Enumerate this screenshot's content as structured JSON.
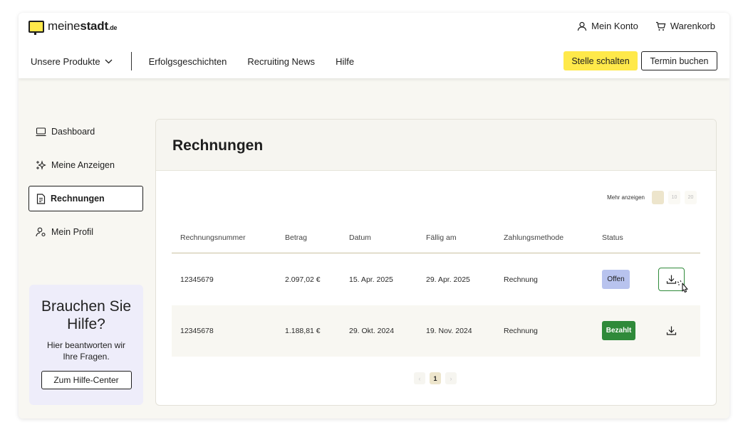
{
  "header": {
    "logo": {
      "pre": "meine",
      "bold": "stadt",
      "suffix": ".de"
    },
    "account_label": "Mein Konto",
    "cart_label": "Warenkorb",
    "products_label": "Unsere Produkte",
    "nav": [
      "Erfolgsgeschichten",
      "Recruiting News",
      "Hilfe"
    ],
    "cta_primary": "Stelle schalten",
    "cta_secondary": "Termin buchen"
  },
  "sidebar": {
    "items": [
      {
        "label": "Dashboard",
        "icon": "laptop-icon"
      },
      {
        "label": "Meine Anzeigen",
        "icon": "sparkle-icon"
      },
      {
        "label": "Rechnungen",
        "icon": "document-icon",
        "active": true
      },
      {
        "label": "Mein Profil",
        "icon": "user-settings-icon"
      }
    ],
    "help": {
      "title": "Brauchen Sie Hilfe?",
      "text": "Hier beantworten wir Ihre Fragen.",
      "button": "Zum Hilfe-Center"
    }
  },
  "main": {
    "title": "Rechnungen",
    "more_label": "Mehr anzeigen",
    "page_size_options": [
      "5",
      "10",
      "20"
    ],
    "columns": [
      "Rechnungsnummer",
      "Betrag",
      "Datum",
      "Fällig am",
      "Zahlungsmethode",
      "Status"
    ],
    "rows": [
      {
        "number": "12345679",
        "amount": "2.097,02 €",
        "date": "15. Apr. 2025",
        "due": "29. Apr. 2025",
        "method": "Rechnung",
        "status": "Offen"
      },
      {
        "number": "12345678",
        "amount": "1.188,81 €",
        "date": "29. Okt. 2024",
        "due": "19. Nov. 2024",
        "method": "Rechnung",
        "status": "Bezahlt"
      }
    ],
    "pagination": {
      "prev": "‹",
      "current": "1",
      "next": "›"
    }
  },
  "colors": {
    "accent_yellow": "#ffe94a",
    "paid_green": "#2f8a3a",
    "open_blue": "#b8c3ee",
    "help_bg": "#eeedfa"
  }
}
